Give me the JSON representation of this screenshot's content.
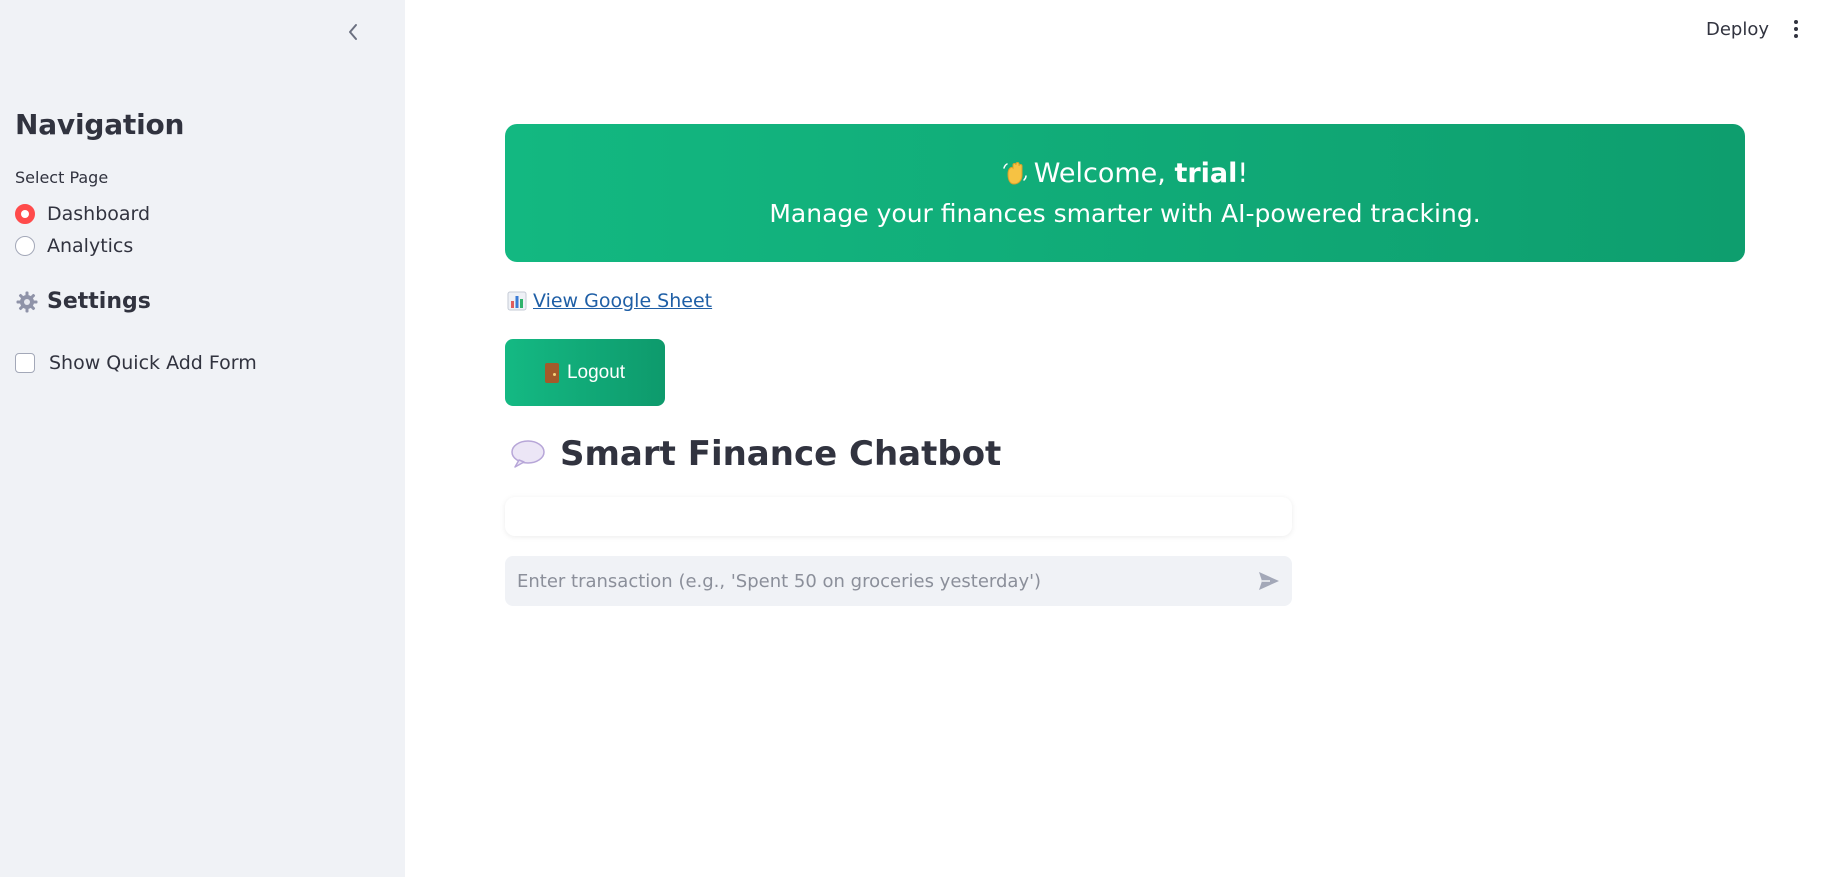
{
  "header": {
    "deploy_label": "Deploy"
  },
  "sidebar": {
    "title": "Navigation",
    "select_label": "Select Page",
    "pages": [
      {
        "label": "Dashboard",
        "selected": true
      },
      {
        "label": "Analytics",
        "selected": false
      }
    ],
    "settings_title": "Settings",
    "quick_add_label": "Show Quick Add Form",
    "quick_add_checked": false
  },
  "banner": {
    "welcome_prefix": "Welcome, ",
    "username": "trial",
    "welcome_suffix": "!",
    "subtitle": "Manage your finances smarter with AI-powered tracking."
  },
  "links": {
    "sheet_label": "View Google Sheet"
  },
  "logout": {
    "label": "Logout"
  },
  "chatbot": {
    "title": "Smart Finance Chatbot",
    "input_placeholder": "Enter transaction (e.g., 'Spent 50 on groceries yesterday')",
    "input_value": ""
  },
  "colors": {
    "accent": "#ff4b4b",
    "banner_start": "#13b881",
    "banner_end": "#0e9e6e",
    "sidebar_bg": "#f0f2f6",
    "link": "#1f5fa6"
  },
  "icons": {
    "collapse": "chevron-left-icon",
    "menu": "kebab-menu-icon",
    "settings": "gear-icon",
    "wave": "waving-hand-icon",
    "sheet": "bar-chart-icon",
    "logout": "door-icon",
    "chat": "speech-bubble-icon",
    "send": "send-arrow-icon"
  }
}
